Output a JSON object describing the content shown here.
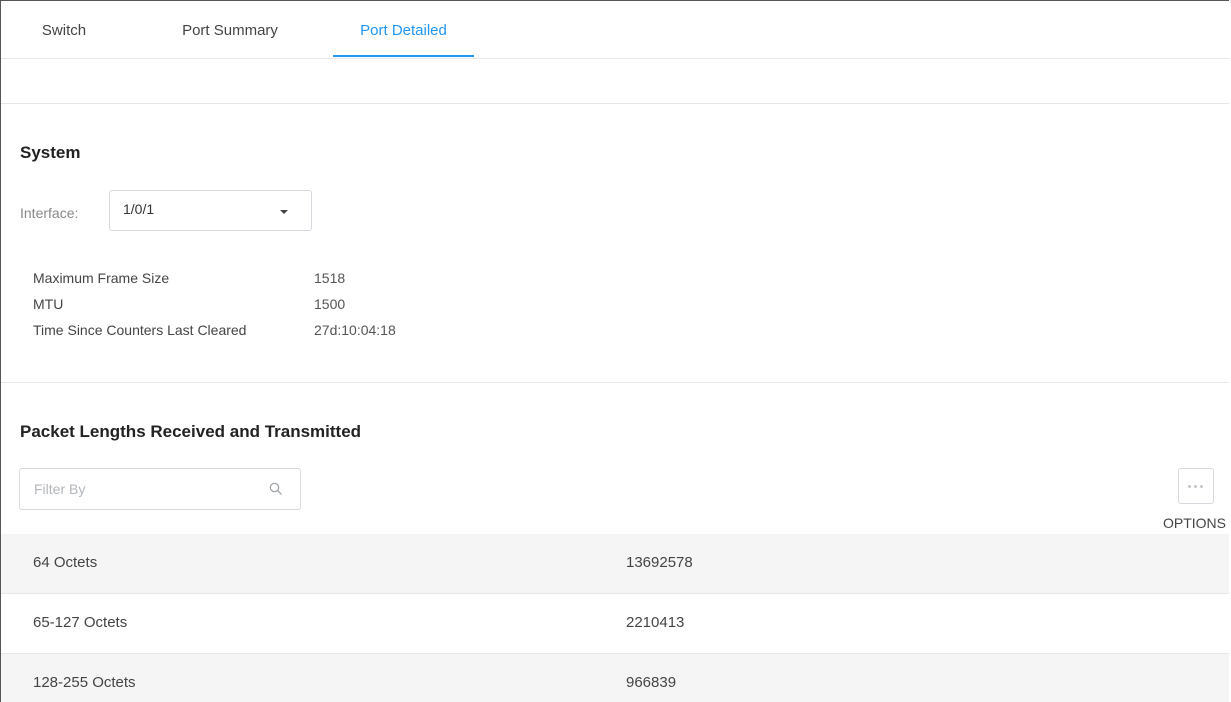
{
  "tabs": [
    {
      "label": "Switch"
    },
    {
      "label": "Port Summary"
    },
    {
      "label": "Port Detailed"
    }
  ],
  "system": {
    "title": "System",
    "interface_label": "Interface:",
    "interface_value": "1/0/1",
    "details": [
      {
        "label": "Maximum Frame Size",
        "value": "1518"
      },
      {
        "label": "MTU",
        "value": "1500"
      },
      {
        "label": "Time Since Counters Last Cleared",
        "value": "27d:10:04:18"
      }
    ]
  },
  "packets": {
    "title": "Packet Lengths Received and Transmitted",
    "filter_placeholder": "Filter By",
    "options_label": "OPTIONS",
    "rows": [
      {
        "label": "64 Octets",
        "value": "13692578"
      },
      {
        "label": "65-127 Octets",
        "value": "2210413"
      },
      {
        "label": "128-255 Octets",
        "value": "966839"
      }
    ]
  },
  "colors": {
    "accent": "#2196f3",
    "row_alt": "#f5f5f5",
    "border": "#e4e6e9"
  },
  "icons": {
    "search": "search-icon",
    "options": "more-horizontal-icon",
    "dropdown": "caret-down-icon"
  }
}
